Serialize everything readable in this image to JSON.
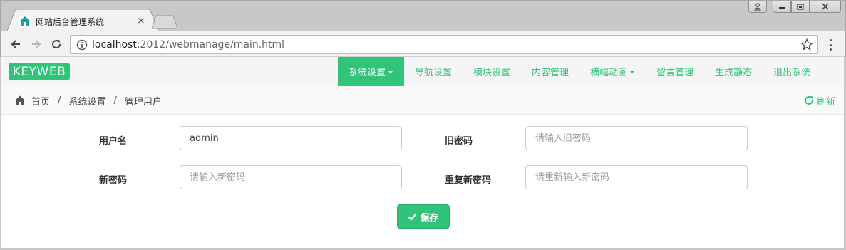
{
  "browser": {
    "tab_title": "网站后台管理系统",
    "tab_close": "×",
    "url_host": "localhost",
    "url_rest": ":2012/webmanage/main.html"
  },
  "navbar": {
    "logo": "KEYWEB",
    "menu": [
      {
        "label": "系统设置",
        "active": true,
        "dropdown": true
      },
      {
        "label": "导航设置"
      },
      {
        "label": "模块设置"
      },
      {
        "label": "内容管理"
      },
      {
        "label": "横幅动画",
        "dropdown": true
      },
      {
        "label": "留言管理"
      },
      {
        "label": "生成静态"
      },
      {
        "label": "退出系统"
      }
    ]
  },
  "breadcrumb": {
    "home": "首页",
    "sep": "/",
    "level1": "系统设置",
    "level2": "管理用户",
    "refresh": "刷新"
  },
  "form": {
    "username_label": "用户名",
    "username_value": "admin",
    "old_password_label": "旧密码",
    "old_password_placeholder": "请输入旧密码",
    "new_password_label": "新密码",
    "new_password_placeholder": "请输入新密码",
    "repeat_password_label": "重复新密码",
    "repeat_password_placeholder": "请重新输入新密码",
    "save_label": "保存"
  },
  "colors": {
    "accent": "#2fc47a"
  }
}
